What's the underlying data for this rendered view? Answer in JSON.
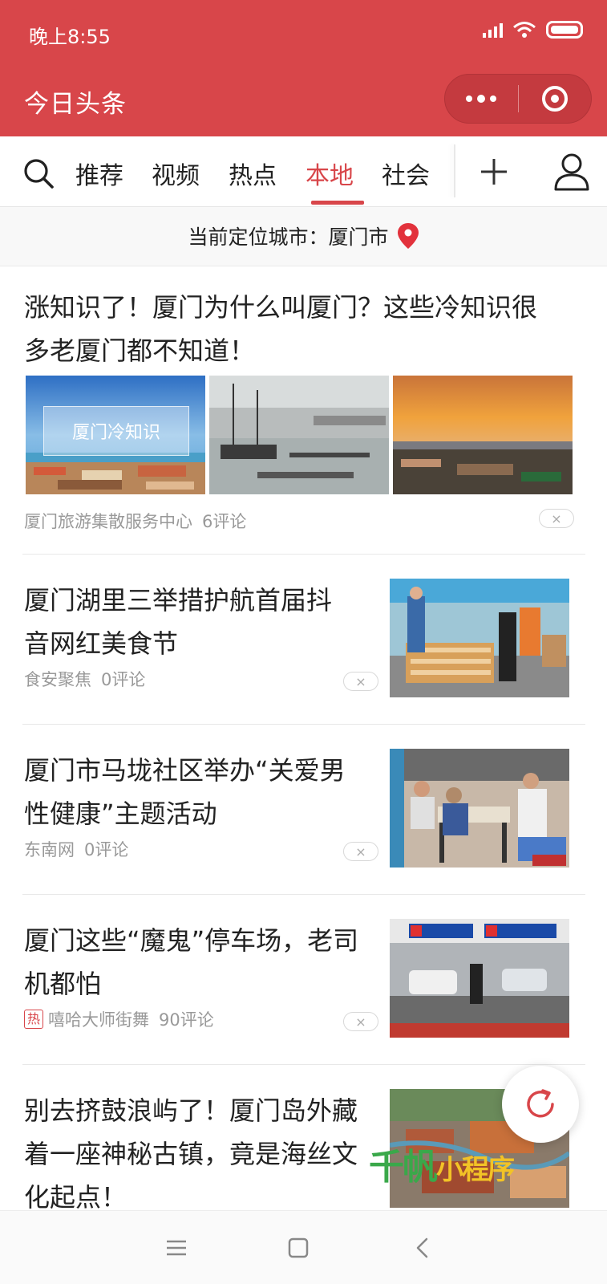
{
  "status_bar": {
    "time": "晚上8:55",
    "signal_icon": "signal-icon",
    "wifi_icon": "wifi-icon",
    "battery_icon": "battery-icon"
  },
  "title_bar": {
    "app_title": "今日头条",
    "more_icon": "more-dots-icon",
    "close_icon": "target-close-icon"
  },
  "channels": {
    "tabs": [
      {
        "label": "推荐"
      },
      {
        "label": "视频"
      },
      {
        "label": "热点"
      },
      {
        "label": "本地"
      },
      {
        "label": "社会"
      }
    ],
    "active_tab": "本地",
    "search_icon": "search-icon",
    "add_icon": "plus-icon",
    "user_icon": "user-icon"
  },
  "location": {
    "text": "当前定位城市：厦门市",
    "pin_icon": "location-pin-icon"
  },
  "feed": [
    {
      "title_line1": "涨知识了！厦门为什么叫厦门？这些冷知识很",
      "title_line2": "多老厦门都不知道！",
      "thumb_caption": "厦门冷知识",
      "source": "厦门旅游集散服务中心",
      "comments": "6评论"
    },
    {
      "title_line1": "厦门湖里三举措护航首届抖",
      "title_line2": "音网红美食节",
      "source": "食安聚焦",
      "comments": "0评论"
    },
    {
      "title_line1": "厦门市马垅社区举办“关爱男",
      "title_line2": "性健康”主题活动",
      "source": "东南网",
      "comments": "0评论"
    },
    {
      "title_line1": "厦门这些“魔鬼”停车场，老司",
      "title_line2": "机都怕",
      "hot_tag": "热",
      "source": "嘻哈大师街舞",
      "comments": "90评论"
    },
    {
      "title_line1": "别去挤鼓浪屿了！厦门岛外藏",
      "title_line2": "着一座神秘古镇，竟是海丝文",
      "title_line3": "化起点！"
    }
  ],
  "dislike_label": "×",
  "refresh_icon": "refresh-icon",
  "watermark": {
    "part1": "千帆",
    "part2": "小程序"
  },
  "colors": {
    "brand_red": "#d8464a",
    "text": "#222222",
    "meta": "#999999"
  }
}
